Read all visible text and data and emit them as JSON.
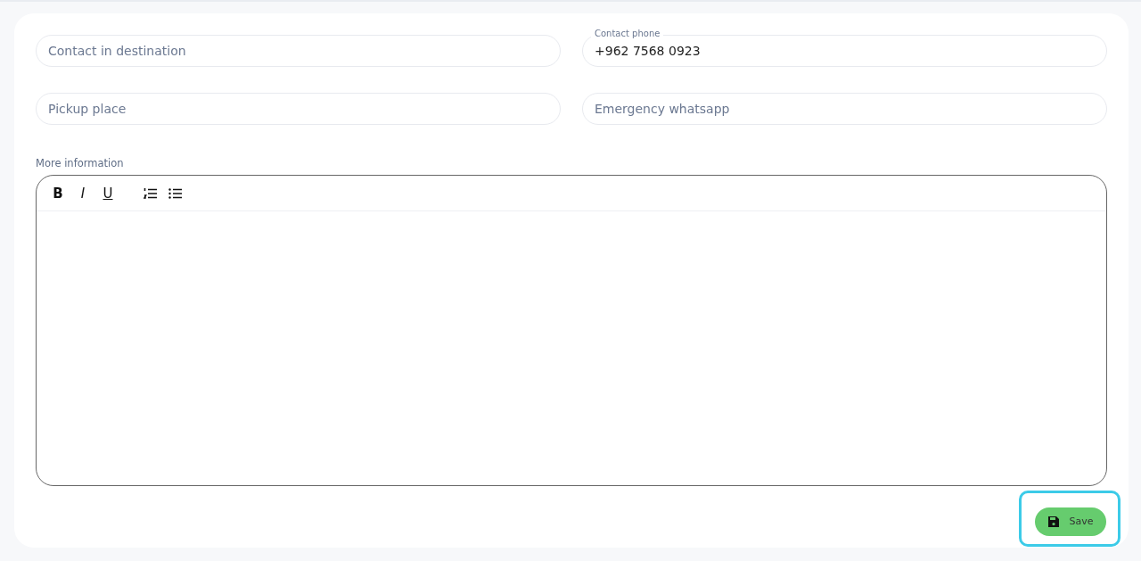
{
  "field_rows": [
    {
      "left": {
        "placeholder": "Contact in destination"
      },
      "right": {
        "label": "Contact phone",
        "value": "+962 7568 0923"
      }
    },
    {
      "left": {
        "placeholder": "Pickup place"
      },
      "right": {
        "placeholder": "Emergency whatsapp"
      }
    }
  ],
  "editor": {
    "label": "More information",
    "toolbar": [
      {
        "kind": "bold",
        "label": "B"
      },
      {
        "kind": "italic",
        "label": "I"
      },
      {
        "kind": "underline",
        "label": "U"
      },
      {
        "kind": "ordered-list"
      },
      {
        "kind": "bullet-list"
      }
    ]
  },
  "save_button": {
    "label": "Save",
    "focused": true
  }
}
